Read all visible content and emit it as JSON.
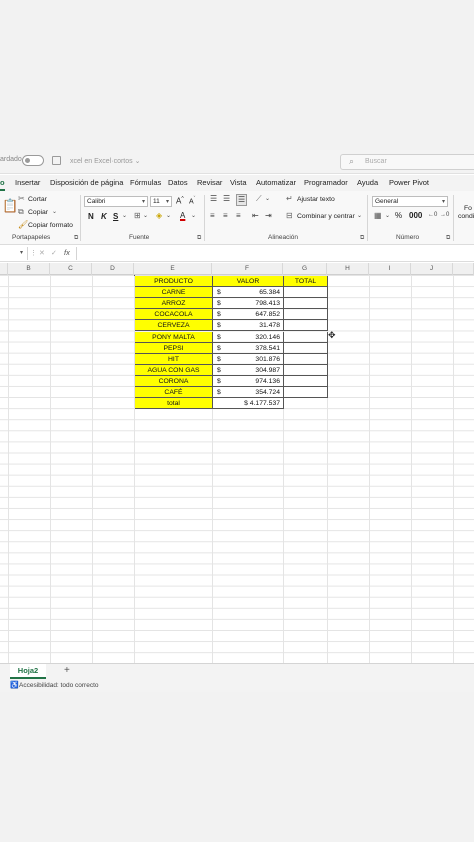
{
  "titlebar": {
    "autosave_label": "ardado",
    "doc_title": "xcel en Excel·cortos ⌄",
    "search_placeholder": "Buscar",
    "search_icon": "search-icon"
  },
  "menu": {
    "items": [
      "o",
      "Insertar",
      "Disposición de página",
      "Fórmulas",
      "Datos",
      "Revisar",
      "Vista",
      "Automatizar",
      "Programador",
      "Ayuda",
      "Power Pivot"
    ]
  },
  "ribbon": {
    "clipboard": {
      "cut": "Cortar",
      "copy": "Copiar",
      "format_painter": "Copiar formato",
      "label": "Portapapeles"
    },
    "font": {
      "name": "Calibri",
      "size": "11",
      "bold": "N",
      "italic": "K",
      "underline": "S",
      "label": "Fuente"
    },
    "alignment": {
      "wrap": "Ajustar texto",
      "merge": "Combinar y centrar",
      "label": "Alineación"
    },
    "number": {
      "format": "General",
      "label": "Número"
    },
    "styles": {
      "cond_fmt_1": "Fo",
      "cond_fmt_2": "condi"
    }
  },
  "formula_bar": {
    "name_box": "",
    "fx": "fx"
  },
  "columns": [
    "B",
    "C",
    "D",
    "E",
    "F",
    "G",
    "H",
    "I",
    "J"
  ],
  "table": {
    "headers": [
      "PRODUCTO",
      "VALOR",
      "TOTAL"
    ],
    "rows": [
      {
        "product": "CARNE",
        "currency": "$",
        "value": "65.384"
      },
      {
        "product": "ARROZ",
        "currency": "$",
        "value": "798.413"
      },
      {
        "product": "COCACOLA",
        "currency": "$",
        "value": "647.852"
      },
      {
        "product": "CERVEZA",
        "currency": "$",
        "value": "31.478"
      },
      {
        "product": "PONY MALTA",
        "currency": "$",
        "value": "320.146"
      },
      {
        "product": "PEPSI",
        "currency": "$",
        "value": "378.541"
      },
      {
        "product": "HIT",
        "currency": "$",
        "value": "301.876"
      },
      {
        "product": "AGUA CON GAS",
        "currency": "$",
        "value": "304.987"
      },
      {
        "product": "CORONA",
        "currency": "$",
        "value": "974.136"
      },
      {
        "product": "CAFÉ",
        "currency": "$",
        "value": "354.724"
      }
    ],
    "total_label": "total",
    "total_value": "$ 4.177.537"
  },
  "sheets": {
    "active": "Hoja2",
    "add": "+"
  },
  "status": {
    "text": "Accesibilidad: todo correcto"
  }
}
